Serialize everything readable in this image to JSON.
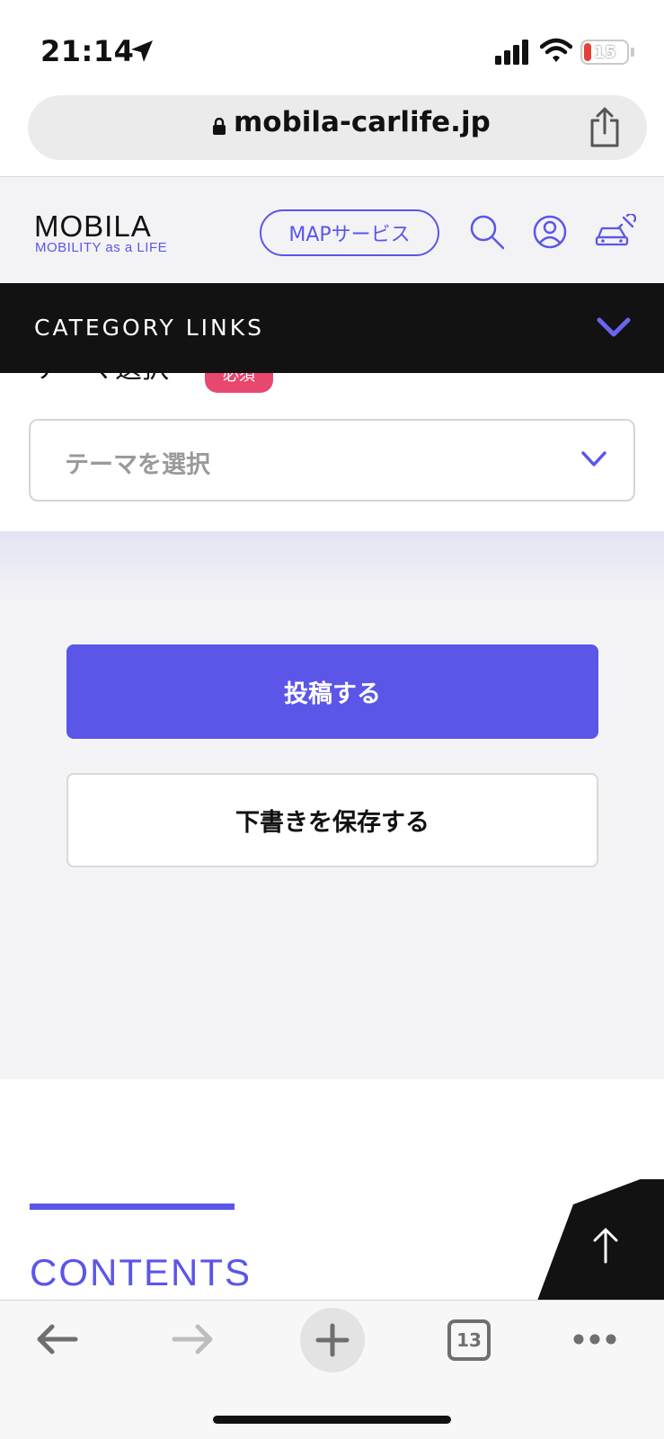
{
  "status_bar": {
    "time": "21:14",
    "battery": "15"
  },
  "browser": {
    "url": "mobila-carlife.jp",
    "tab_count": "13"
  },
  "header": {
    "logo": "MOBILA",
    "tagline": "MOBILITY as a LIFE",
    "map_button": "MAPサービス"
  },
  "category_bar": {
    "label": "CATEGORY LINKS"
  },
  "form": {
    "theme_label_partial": "テーマ選択",
    "required_badge": "必須",
    "theme_placeholder": "テーマを選択",
    "submit_label": "投稿する",
    "draft_label": "下書きを保存する"
  },
  "contents": {
    "title": "CONTENTS"
  },
  "colors": {
    "accent": "#5b56e8",
    "dark": "#121212",
    "badge": "#e8476f",
    "battery_low": "#e5413a"
  }
}
